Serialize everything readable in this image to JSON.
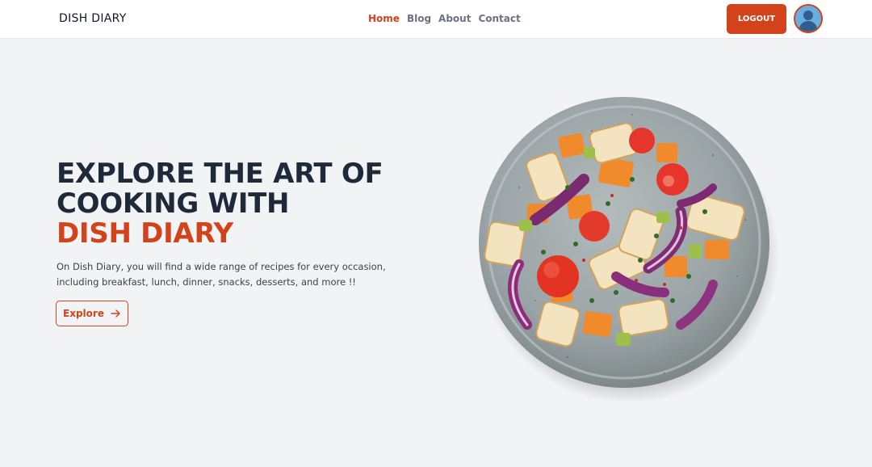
{
  "brand": "DISH DIARY",
  "nav": [
    {
      "label": "Home",
      "active": true
    },
    {
      "label": "Blog",
      "active": false
    },
    {
      "label": "About",
      "active": false
    },
    {
      "label": "Contact",
      "active": false
    }
  ],
  "header": {
    "logout_label": "LOGOUT"
  },
  "hero": {
    "title_line1": "EXPLORE THE ART OF",
    "title_line2": "COOKING WITH",
    "title_accent": "DISH DIARY",
    "description": "On Dish Diary, you will find a wide range of recipes for every occasion, including breakfast, lunch, dinner, snacks, desserts, and more !!",
    "cta_label": "Explore",
    "cta_icon": "arrow-right-icon"
  },
  "colors": {
    "accent": "#d2431b",
    "background": "#f2f3f5",
    "title": "#1e2a3a"
  }
}
